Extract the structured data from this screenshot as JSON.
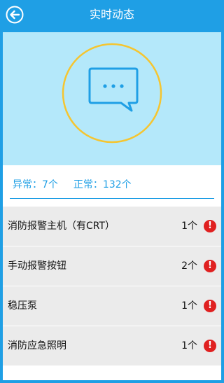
{
  "header": {
    "title": "实时动态",
    "back_icon": "back-arrow-icon"
  },
  "hero": {
    "icon": "chat-bubble-icon",
    "ring_color": "#f5c530",
    "icon_color": "#1f9fe5",
    "background": "#b4e8fa"
  },
  "summary": {
    "abnormal_label": "异常：",
    "abnormal_count": "7个",
    "normal_label": "正常：",
    "normal_count": "132个"
  },
  "items": [
    {
      "name": "消防报警主机（有CRT）",
      "count": "1个",
      "status_icon": "alert-icon"
    },
    {
      "name": "手动报警按钮",
      "count": "2个",
      "status_icon": "alert-icon"
    },
    {
      "name": "稳压泵",
      "count": "1个",
      "status_icon": "alert-icon"
    },
    {
      "name": "消防应急照明",
      "count": "1个",
      "status_icon": "alert-icon"
    }
  ],
  "colors": {
    "accent": "#1f9fe5",
    "alert": "#e02020",
    "row_bg": "#ebebeb"
  }
}
